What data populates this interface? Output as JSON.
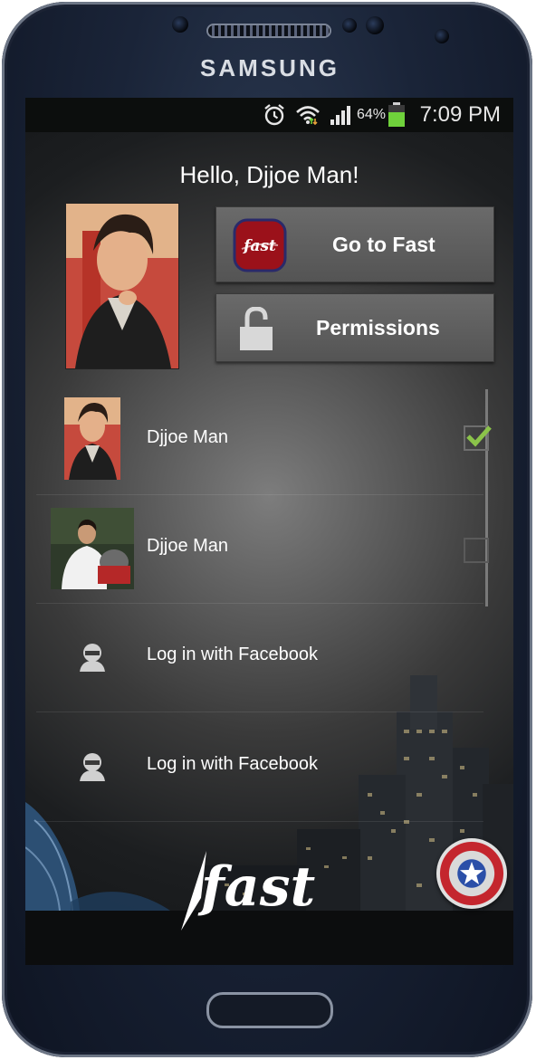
{
  "device": {
    "brand": "SAMSUNG"
  },
  "status_bar": {
    "battery_percent": "64%",
    "time": "7:09 PM"
  },
  "greeting": "Hello, Djjoe Man!",
  "buttons": {
    "go_to_fast": "Go to Fast",
    "permissions": "Permissions"
  },
  "accounts": [
    {
      "name": "Djjoe Man",
      "checked": true
    },
    {
      "name": "Djjoe Man",
      "checked": false
    },
    {
      "name": "Log in with Facebook"
    },
    {
      "name": "Log in with Facebook"
    }
  ],
  "app_logo": "fast",
  "icons": {
    "alarm": "alarm-icon",
    "wifi": "wifi-icon",
    "signal": "signal-icon",
    "battery": "battery-icon",
    "lock": "lock-icon",
    "user": "user-icon",
    "shield": "shield-icon"
  },
  "colors": {
    "check_green": "#8bc34a",
    "battery_green": "#6fd13b",
    "button_gray": "#5e5e5e"
  }
}
